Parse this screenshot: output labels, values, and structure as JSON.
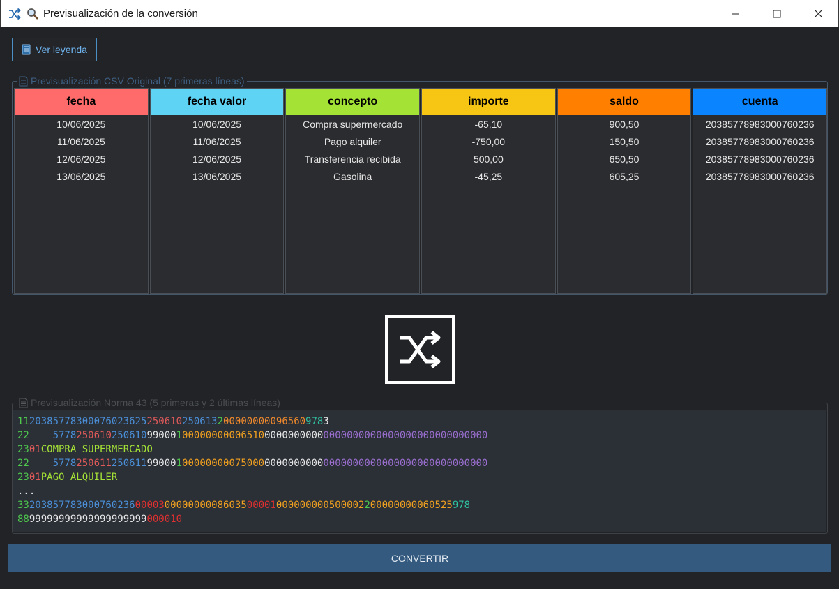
{
  "window": {
    "title": "Previsualización de la conversión",
    "app_icon": "shuffle-icon",
    "search_icon": "magnifier-icon"
  },
  "legend_button": {
    "label": "Ver leyenda",
    "icon": "notebook-icon"
  },
  "csv_preview": {
    "title": "Previsualización CSV Original (7 primeras líneas)",
    "columns": [
      {
        "header": "fecha",
        "color": "#ff6b6b",
        "cells": [
          "10/06/2025",
          "11/06/2025",
          "12/06/2025",
          "13/06/2025"
        ]
      },
      {
        "header": "fecha valor",
        "color": "#5ed3f3",
        "cells": [
          "10/06/2025",
          "11/06/2025",
          "12/06/2025",
          "13/06/2025"
        ]
      },
      {
        "header": "concepto",
        "color": "#a5e236",
        "cells": [
          "Compra supermercado",
          "Pago alquiler",
          "Transferencia recibida",
          "Gasolina"
        ]
      },
      {
        "header": "importe",
        "color": "#f7c614",
        "cells": [
          "-65,10",
          "-750,00",
          "500,00",
          "-45,25"
        ]
      },
      {
        "header": "saldo",
        "color": "#ff7f00",
        "cells": [
          "900,50",
          "150,50",
          "650,50",
          "605,25"
        ]
      },
      {
        "header": "cuenta",
        "color": "#0a84ff",
        "cells": [
          "20385778983000760236",
          "20385778983000760236",
          "20385778983000760236",
          "20385778983000760236"
        ]
      }
    ]
  },
  "norma43_preview": {
    "title": "Previsualización Norma 43 (5 primeras y 2 últimas líneas)",
    "lines": [
      [
        [
          "11",
          "#4ec94e"
        ],
        [
          "20385778300076023625",
          "#4a8fd8"
        ],
        [
          "2506",
          "#e05a5a"
        ],
        [
          "10",
          "#e05a5a"
        ],
        [
          "250613",
          "#4a8fd8"
        ],
        [
          "2",
          "#4ec94e"
        ],
        [
          "00000000",
          "#f08a2c"
        ],
        [
          "0965",
          "#f08a2c"
        ],
        [
          "60",
          "#f08a2c"
        ],
        [
          "978",
          "#2fc2a0"
        ],
        [
          "3",
          "#e6e6e6"
        ]
      ],
      [
        [
          "22",
          "#4ec94e"
        ],
        [
          "    ",
          "#e6e6e6"
        ],
        [
          "5778",
          "#4a8fd8"
        ],
        [
          "250610",
          "#e05a5a"
        ],
        [
          "250610",
          "#4a8fd8"
        ],
        [
          "99000",
          "#e6e6e6"
        ],
        [
          "1",
          "#4ec94e"
        ],
        [
          "0000000000651",
          "#f0a020"
        ],
        [
          "0",
          "#f0a020"
        ],
        [
          "0000000000",
          "#e6e6e6"
        ],
        [
          "0000000000000000000000000000",
          "#9a6fd0"
        ]
      ],
      [
        [
          "23",
          "#4ec94e"
        ],
        [
          "01",
          "#e05a5a"
        ],
        [
          "COMPRA SUPERMERCADO",
          "#a5e236"
        ]
      ],
      [
        [
          "22",
          "#4ec94e"
        ],
        [
          "    ",
          "#e6e6e6"
        ],
        [
          "5778",
          "#4a8fd8"
        ],
        [
          "250611",
          "#e05a5a"
        ],
        [
          "250611",
          "#4a8fd8"
        ],
        [
          "99000",
          "#e6e6e6"
        ],
        [
          "1",
          "#4ec94e"
        ],
        [
          "0000000007500",
          "#f0a020"
        ],
        [
          "0",
          "#f0a020"
        ],
        [
          "0000000000",
          "#e6e6e6"
        ],
        [
          "0000000000000000000000000000",
          "#9a6fd0"
        ]
      ],
      [
        [
          "23",
          "#4ec94e"
        ],
        [
          "01",
          "#e05a5a"
        ],
        [
          "PAGO ALQUILER",
          "#a5e236"
        ]
      ],
      [
        [
          "...",
          "#e6e6e6"
        ]
      ],
      [
        [
          "33",
          "#4ec94e"
        ],
        [
          "20385778300076023",
          "#4a8fd8"
        ],
        [
          "6",
          "#4a8fd8"
        ],
        [
          "00003",
          "#e03030"
        ],
        [
          "0000000008603",
          "#f0a020"
        ],
        [
          "5",
          "#f0a020"
        ],
        [
          "00001",
          "#e03030"
        ],
        [
          "000000000500002",
          "#f0a020"
        ],
        [
          "2",
          "#4ec94e"
        ],
        [
          "0000000006052",
          "#f0a020"
        ],
        [
          "5",
          "#f0a020"
        ],
        [
          "978",
          "#2fc2a0"
        ]
      ],
      [
        [
          "88",
          "#4ec94e"
        ],
        [
          "99999999999999999999",
          "#e6e6e6"
        ],
        [
          "000010",
          "#e03030"
        ]
      ]
    ]
  },
  "convert_icon": "shuffle-icon",
  "convert_button": {
    "label": "CONVERTIR"
  }
}
